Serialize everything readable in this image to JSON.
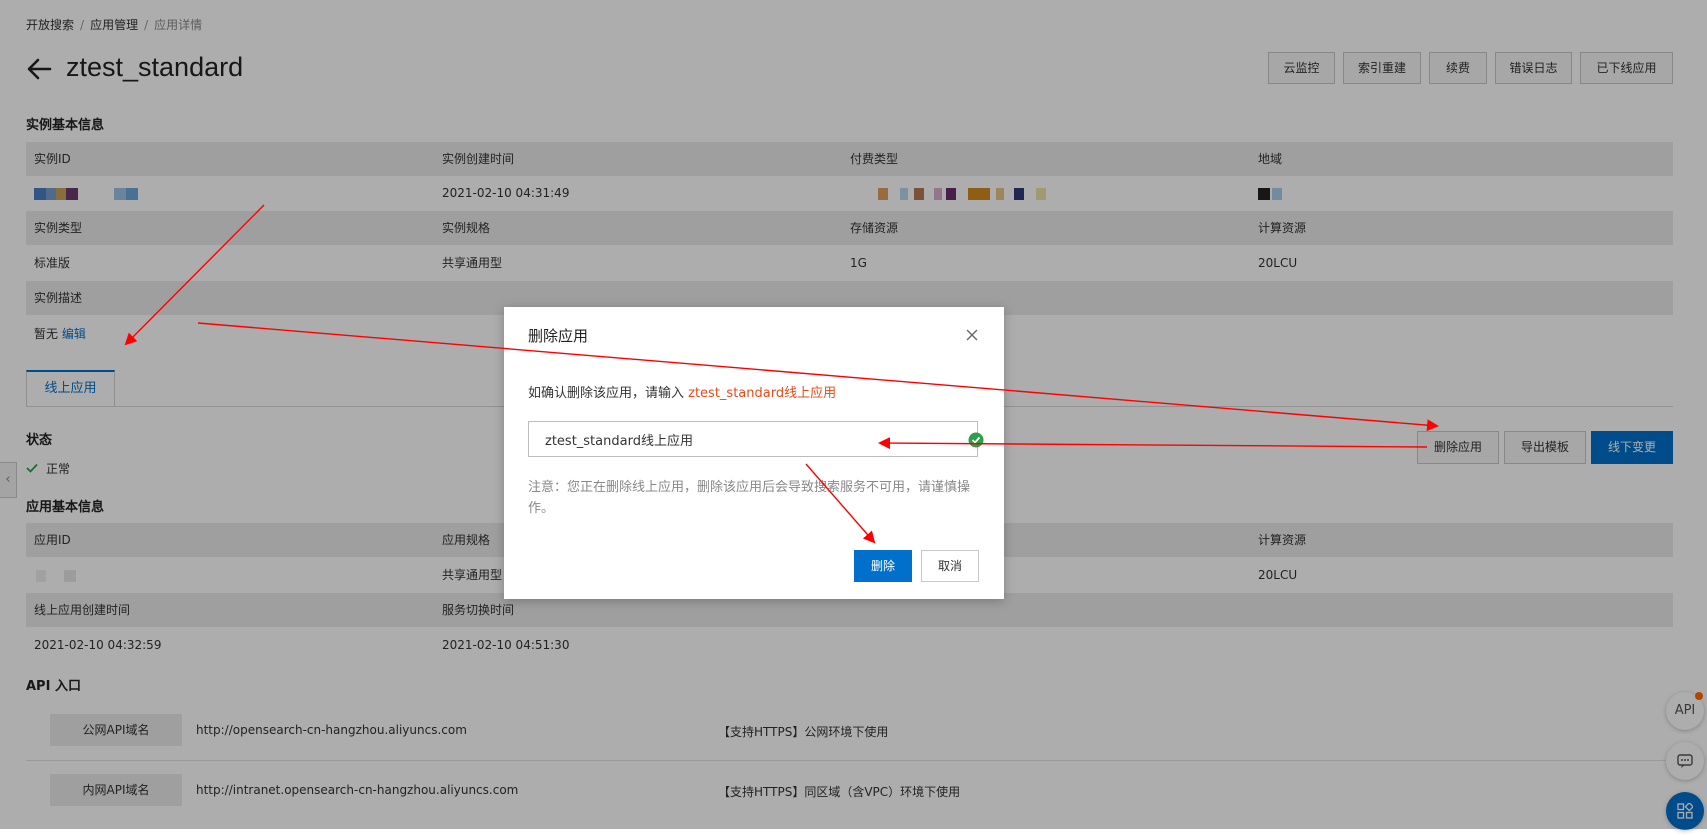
{
  "breadcrumb": [
    "开放搜索",
    "应用管理",
    "应用详情"
  ],
  "breadcrumb_sep": "/",
  "title": "ztest_standard",
  "header_buttons": [
    "云监控",
    "索引重建",
    "续费",
    "错误日志",
    "已下线应用"
  ],
  "instance_info": {
    "title": "实例基本信息",
    "rows": [
      {
        "type": "head",
        "cells": [
          "实例ID",
          "实例创建时间",
          "付费类型",
          "地域"
        ]
      },
      {
        "type": "value",
        "cells": [
          "",
          "2021-02-10 04:31:49",
          "",
          ""
        ]
      },
      {
        "type": "head",
        "cells": [
          "实例类型",
          "实例规格",
          "存储资源",
          "计算资源"
        ]
      },
      {
        "type": "value",
        "cells": [
          "标准版",
          "共享通用型",
          "1G",
          "20LCU"
        ]
      },
      {
        "type": "head",
        "cells": [
          "实例描述",
          "",
          "",
          ""
        ]
      }
    ],
    "desc_value": "暂无",
    "desc_edit": "编辑"
  },
  "tab_label": "线上应用",
  "status": {
    "title": "状态",
    "value": "正常"
  },
  "app_actions": [
    "删除应用",
    "导出模板",
    "线下变更"
  ],
  "app_info": {
    "title": "应用基本信息",
    "rows": [
      {
        "type": "head",
        "cells": [
          "应用ID",
          "应用规格",
          "",
          "计算资源"
        ]
      },
      {
        "type": "value",
        "cells": [
          "",
          "共享通用型",
          "",
          "20LCU"
        ]
      },
      {
        "type": "head",
        "cells": [
          "线上应用创建时间",
          "服务切换时间",
          "",
          ""
        ]
      },
      {
        "type": "value",
        "cells": [
          "2021-02-10 04:32:59",
          "2021-02-10 04:51:30",
          "",
          ""
        ]
      }
    ]
  },
  "api": {
    "title": "API 入口",
    "rows": [
      {
        "label": "公网API域名",
        "url": "http://opensearch-cn-hangzhou.aliyuncs.com",
        "note": "【支持HTTPS】公网环境下使用"
      },
      {
        "label": "内网API域名",
        "url": "http://intranet.opensearch-cn-hangzhou.aliyuncs.com",
        "note": "【支持HTTPS】同区域（含VPC）环境下使用"
      }
    ]
  },
  "float_buttons": {
    "api": "API"
  },
  "modal": {
    "title": "删除应用",
    "message_prefix": "如确认删除该应用，请输入 ",
    "message_highlight": "ztest_standard线上应用",
    "input_value": "ztest_standard线上应用",
    "note": "注意：您正在删除线上应用，删除该应用后会导致搜索服务不可用，请谨慎操作。",
    "confirm_label": "删除",
    "cancel_label": "取消"
  },
  "colors": {
    "primary": "#0070cc",
    "highlight": "#e64a19",
    "annotation_arrow": "#ff0000",
    "success": "#2e9e4a"
  }
}
